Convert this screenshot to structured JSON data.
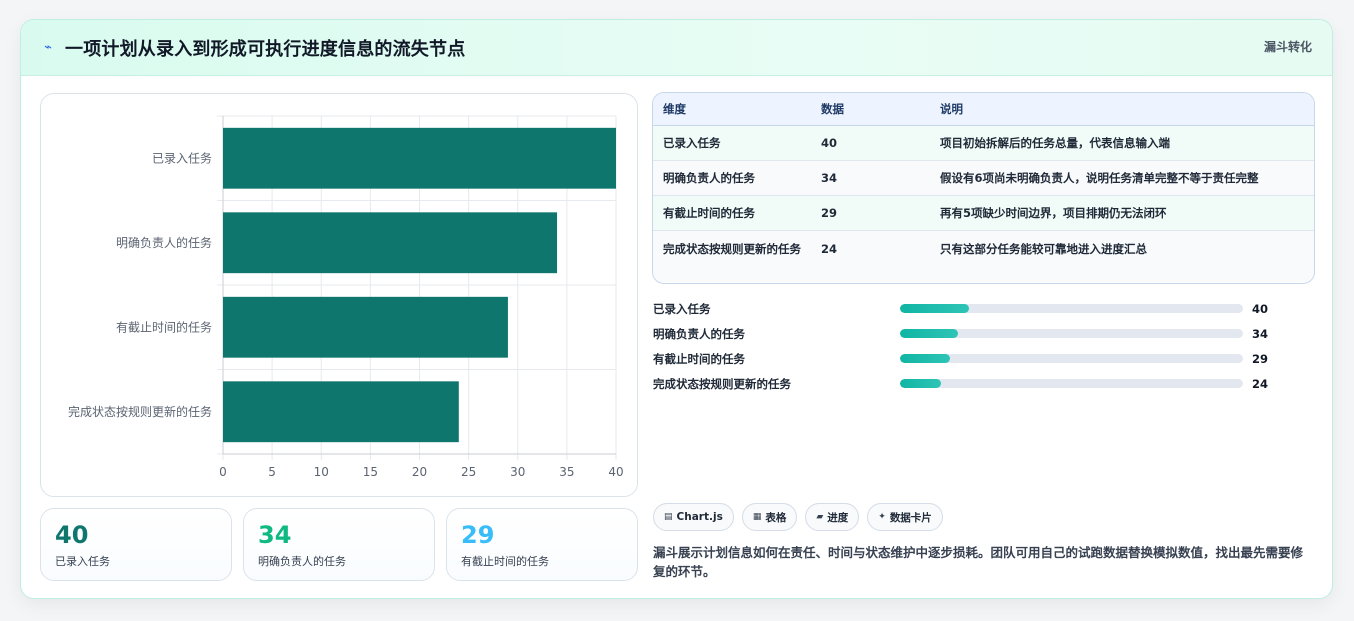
{
  "header": {
    "title": "一项计划从录入到形成可执行进度信息的流失节点",
    "tag": "漏斗转化",
    "icon": "lightning-icon"
  },
  "chart_data": {
    "type": "bar",
    "orientation": "horizontal",
    "categories": [
      "已录入任务",
      "明确负责人的任务",
      "有截止时间的任务",
      "完成状态按规则更新的任务"
    ],
    "values": [
      40,
      34,
      29,
      24
    ],
    "xlim": [
      0,
      40
    ],
    "xticks": [
      0,
      5,
      10,
      15,
      20,
      25,
      30,
      35,
      40
    ],
    "grid": true,
    "bar_color": "#0f766e"
  },
  "stats": [
    {
      "value": "40",
      "label": "已录入任务",
      "color": "#0f766e"
    },
    {
      "value": "34",
      "label": "明确负责人的任务",
      "color": "#10b981"
    },
    {
      "value": "29",
      "label": "有截止时间的任务",
      "color": "#38bdf8"
    }
  ],
  "table": {
    "headers": [
      "维度",
      "数据",
      "说明"
    ],
    "rows": [
      [
        "已录入任务",
        "40",
        "项目初始拆解后的任务总量，代表信息输入端"
      ],
      [
        "明确负责人的任务",
        "34",
        "假设有6项尚未明确负责人，说明任务清单完整不等于责任完整"
      ],
      [
        "有截止时间的任务",
        "29",
        "再有5项缺少时间边界，项目排期仍无法闭环"
      ],
      [
        "完成状态按规则更新的任务",
        "24",
        "只有这部分任务能较可靠地进入进度汇总"
      ]
    ]
  },
  "progress": {
    "max": 200,
    "items": [
      {
        "label": "已录入任务",
        "value": 40
      },
      {
        "label": "明确负责人的任务",
        "value": 34
      },
      {
        "label": "有截止时间的任务",
        "value": 29
      },
      {
        "label": "完成状态按规则更新的任务",
        "value": 24
      }
    ]
  },
  "pills": [
    {
      "icon": "chart-icon",
      "glyph": "▤",
      "label": "Chart.js"
    },
    {
      "icon": "table-icon",
      "glyph": "▦",
      "label": "表格"
    },
    {
      "icon": "progress-icon",
      "glyph": "▰",
      "label": "进度"
    },
    {
      "icon": "sparkle-icon",
      "glyph": "✦",
      "label": "数据卡片"
    }
  ],
  "description": "漏斗展示计划信息如何在责任、时间与状态维护中逐步损耗。团队可用自己的试跑数据替换模拟数值，找出最先需要修复的环节。"
}
